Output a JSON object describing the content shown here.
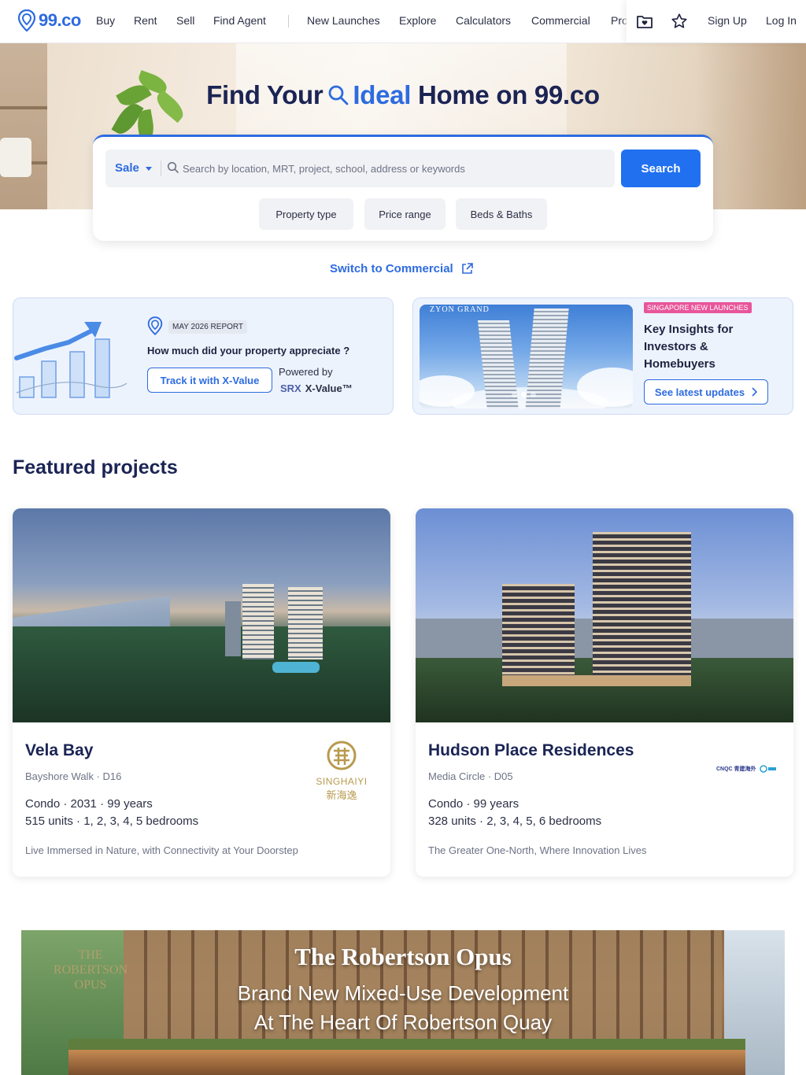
{
  "nav": {
    "logo_text": "99.co",
    "items": [
      "Buy",
      "Rent",
      "Sell",
      "Find Agent",
      "New Launches",
      "Explore",
      "Calculators",
      "Commercial",
      "Pro"
    ],
    "sign_up": "Sign Up",
    "log_in": "Log In",
    "icons": [
      "saved-folder-icon",
      "star-icon"
    ]
  },
  "hero": {
    "title_part1": "Find Your",
    "title_ideal": "Ideal",
    "title_part2": "Home on 99.co"
  },
  "search": {
    "listing_type": "Sale",
    "placeholder": "Search by location, MRT, project, school, address or keywords",
    "button": "Search",
    "filters": [
      "Property type",
      "Price range",
      "Beds & Baths"
    ]
  },
  "switch_commercial": "Switch to Commercial",
  "promo_xvalue": {
    "tag": "MAY 2026 REPORT",
    "question": "How much did your property appreciate ?",
    "button": "Track it with X-Value",
    "powered_by": "Powered by",
    "brand_srx": "SRX",
    "brand_xvalue": "X-Value™"
  },
  "promo_launches": {
    "image_label": "ZYON GRAND",
    "tag": "SINGAPORE NEW LAUNCHES",
    "title": "Key Insights for Investors & Homebuyers",
    "button": "See latest updates"
  },
  "featured": {
    "title": "Featured projects",
    "projects": [
      {
        "name": "Vela Bay",
        "location": "Bayshore Walk · D16",
        "line1": "Condo · 2031 · 99 years",
        "line2": "515 units · 1, 2, 3, 4, 5 bedrooms",
        "tagline": "Live Immersed in Nature, with Connectivity at Your Doorstep",
        "developer": "SINGHAIYI",
        "developer_cn": "新海逸"
      },
      {
        "name": "Hudson Place Residences",
        "location": "Media Circle · D05",
        "line1": "Condo · 99 years",
        "line2": "328 units · 2, 3, 4, 5, 6 bedrooms",
        "tagline": "The Greater One-North, Where Innovation Lives",
        "developer": "CNQC 青建海外"
      }
    ]
  },
  "banner": {
    "title": "The Robertson Opus",
    "subtitle_line1": "Brand New Mixed-Use Development",
    "subtitle_line2": "At The Heart Of Robertson Quay",
    "logo_text": "THE ROBERTSON OPUS"
  },
  "colors": {
    "brand_blue": "#2d6be0",
    "search_button": "#2170f0",
    "heading_navy": "#1b2454",
    "tag_pink": "#e8559a"
  }
}
